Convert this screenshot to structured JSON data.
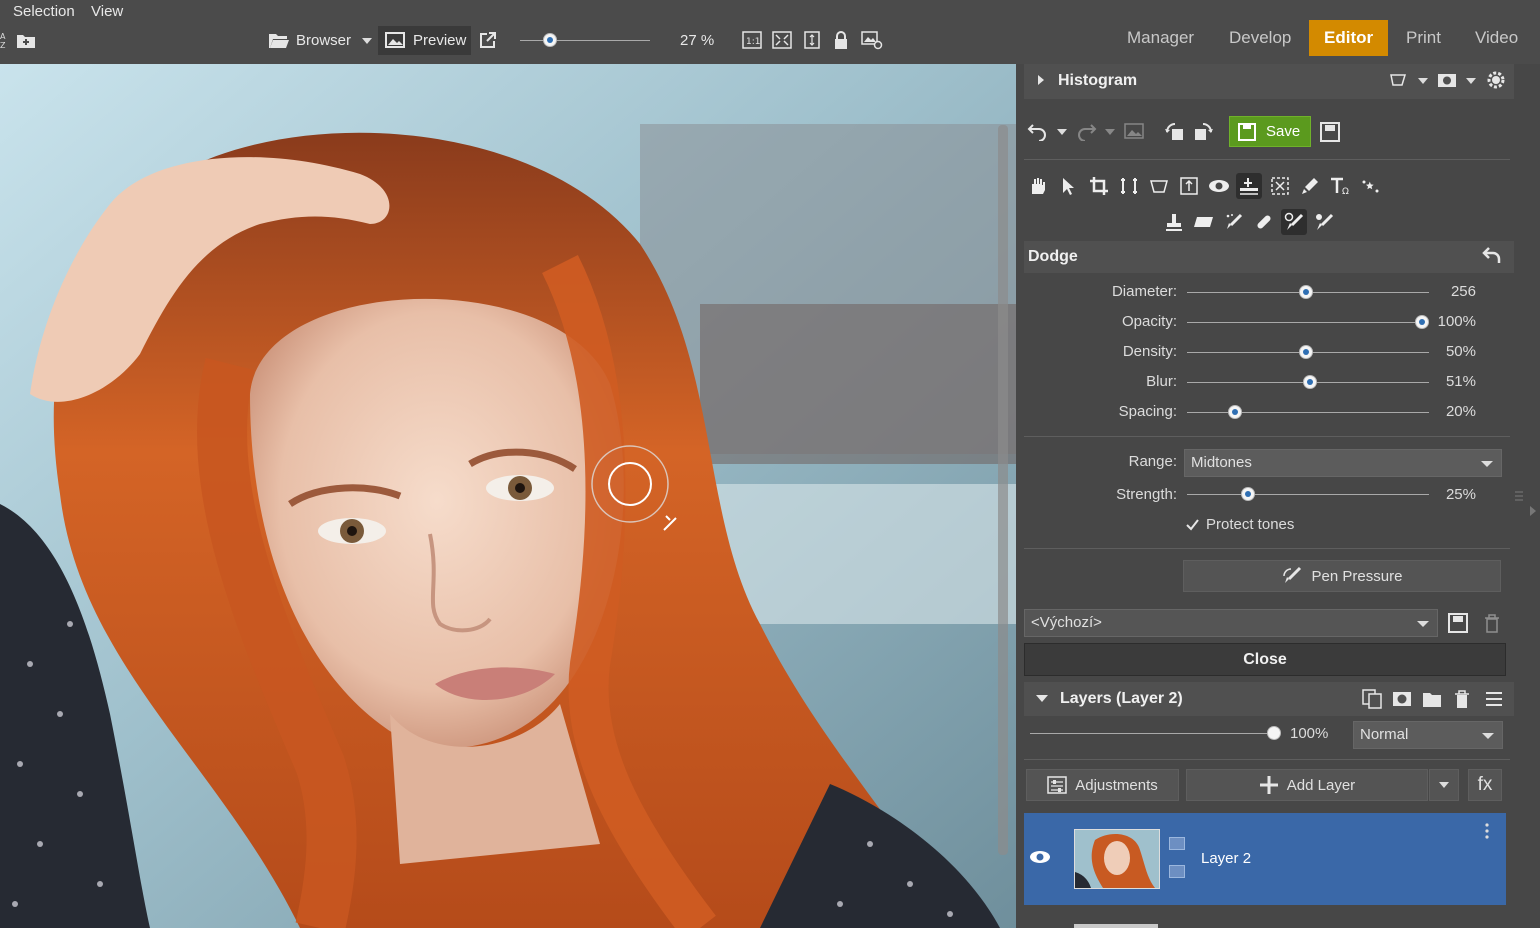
{
  "menu": {
    "selection": "Selection",
    "view": "View"
  },
  "toolbar": {
    "browser": "Browser",
    "preview": "Preview",
    "zoom": "27 %",
    "zoom_level": 0.27
  },
  "nav": {
    "tabs": [
      "Manager",
      "Develop",
      "Editor",
      "Print",
      "Video"
    ],
    "active": "Editor"
  },
  "histogram": {
    "title": "Histogram"
  },
  "actions": {
    "save": "Save"
  },
  "dodge": {
    "title": "Dodge",
    "sliders": [
      {
        "label": "Diameter:",
        "value": "256",
        "fraction": 0.49
      },
      {
        "label": "Opacity:",
        "value": "100%",
        "fraction": 0.97
      },
      {
        "label": "Density:",
        "value": "50%",
        "fraction": 0.49
      },
      {
        "label": "Blur:",
        "value": "51%",
        "fraction": 0.51
      },
      {
        "label": "Spacing:",
        "value": "20%",
        "fraction": 0.2
      }
    ],
    "range_label": "Range:",
    "range_value": "Midtones",
    "strength_label": "Strength:",
    "strength_value": "25%",
    "strength_fraction": 0.25,
    "protect_tones": "Protect tones",
    "pen_pressure": "Pen Pressure",
    "preset": "<Výchozí>",
    "close": "Close"
  },
  "layers": {
    "title": "Layers (Layer 2)",
    "opacity": "100%",
    "opacity_fraction": 1.0,
    "blend_mode": "Normal",
    "adjustments": "Adjustments",
    "add_layer": "Add Layer",
    "fx": "fx",
    "items": [
      {
        "name": "Layer 2"
      }
    ]
  },
  "colors": {
    "accent": "#d38a00",
    "save_green": "#5b9a1e",
    "layer_selected": "#3a68a8"
  }
}
